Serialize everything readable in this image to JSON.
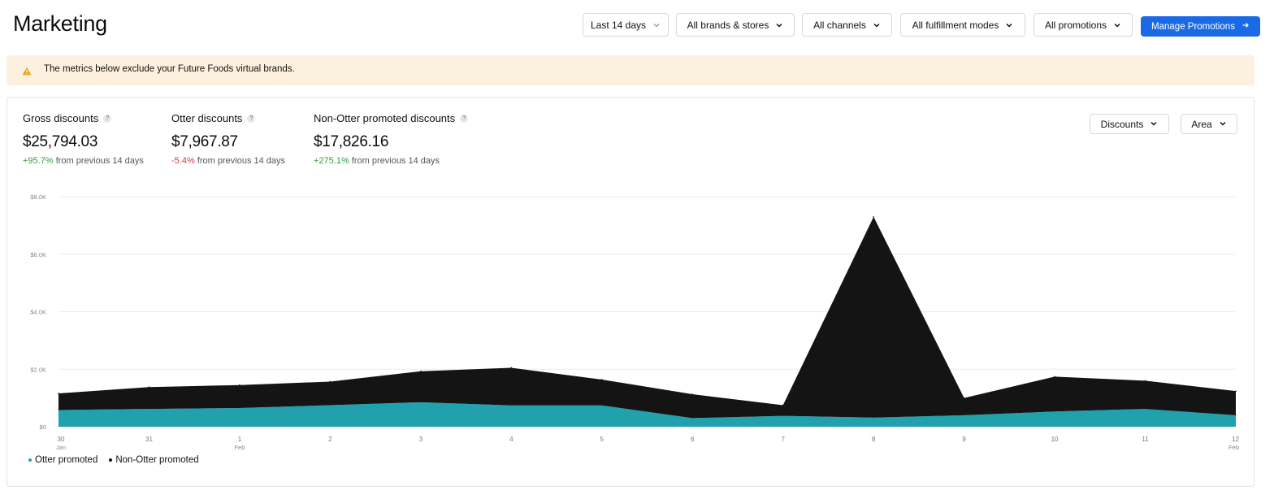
{
  "header": {
    "title": "Marketing",
    "filters": {
      "date": "Last 14 days",
      "brands": "All brands & stores",
      "channels": "All channels",
      "fulfillment": "All fulfillment modes",
      "promotions": "All promotions"
    },
    "manage_button": "Manage Promotions",
    "accent_color": "#1a6ae6"
  },
  "banner": {
    "text": "The metrics below exclude your Future Foods virtual brands.",
    "icon": "warning-icon"
  },
  "metrics": [
    {
      "label": "Gross discounts",
      "value": "$25,794.03",
      "delta": "+95.7%",
      "delta_suffix": "from previous 14 days"
    },
    {
      "label": "Otter discounts",
      "value": "$7,967.87",
      "delta": "-5.4%",
      "delta_suffix": "from previous 14 days"
    },
    {
      "label": "Non-Otter promoted discounts",
      "value": "$17,826.16",
      "delta": "+275.1%",
      "delta_suffix": "from previous 14 days"
    }
  ],
  "controls": {
    "metric_select": "Discounts",
    "chart_type_select": "Area"
  },
  "chart_data": {
    "type": "area",
    "stacked": true,
    "x": [
      "30",
      "31",
      "1",
      "2",
      "3",
      "4",
      "5",
      "6",
      "7",
      "8",
      "9",
      "10",
      "11",
      "12"
    ],
    "x_sublabels": {
      "0": "Jan",
      "2": "Feb",
      "13": "Feb"
    },
    "y_ticks": [
      "$0",
      "$2.0K",
      "$4.0K",
      "$6.0K",
      "$8.0K"
    ],
    "ylim": [
      0,
      8000
    ],
    "grid": true,
    "series": [
      {
        "name": "Otter promoted",
        "color": "#21a0ae",
        "values": [
          580,
          620,
          650,
          750,
          850,
          740,
          740,
          300,
          380,
          320,
          400,
          530,
          620,
          400
        ]
      },
      {
        "name": "Non-Otter promoted",
        "color": "#141414",
        "values": [
          580,
          760,
          800,
          820,
          1080,
          1310,
          900,
          830,
          370,
          6980,
          600,
          1210,
          980,
          840
        ]
      }
    ],
    "legend_position": "bottom-left"
  }
}
